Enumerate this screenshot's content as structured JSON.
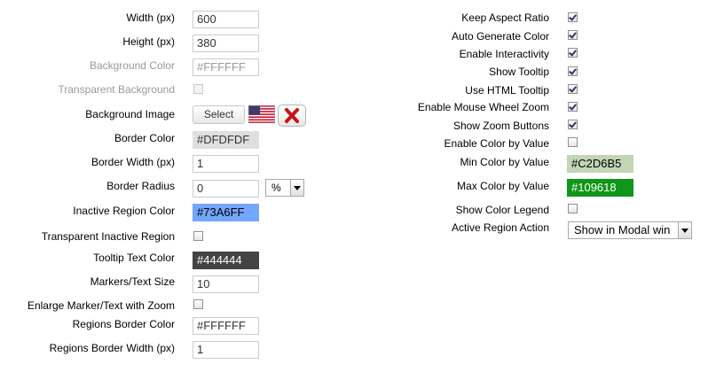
{
  "left": {
    "width": {
      "label": "Width (px)",
      "value": "600"
    },
    "height": {
      "label": "Height (px)",
      "value": "380"
    },
    "background_color": {
      "label": "Background Color",
      "value": "#FFFFFF"
    },
    "transparent_background": {
      "label": "Transparent Background",
      "checked": false
    },
    "background_image": {
      "label": "Background Image",
      "button": "Select"
    },
    "border_color": {
      "label": "Border Color",
      "value": "#DFDFDF",
      "color": "#DFDFDF"
    },
    "border_width": {
      "label": "Border Width (px)",
      "value": "1"
    },
    "border_radius": {
      "label": "Border Radius",
      "value": "0",
      "unit": "%"
    },
    "inactive_region_color": {
      "label": "Inactive Region Color",
      "value": "#73A6FF",
      "color": "#73A6FF"
    },
    "transparent_inactive_region": {
      "label": "Transparent Inactive Region",
      "checked": false
    },
    "tooltip_text_color": {
      "label": "Tooltip Text Color",
      "value": "#444444",
      "color": "#444444"
    },
    "markers_text_size": {
      "label": "Markers/Text Size",
      "value": "10"
    },
    "enlarge_marker": {
      "label": "Enlarge Marker/Text with Zoom",
      "checked": false
    },
    "regions_border_color": {
      "label": "Regions Border Color",
      "value": "#FFFFFF",
      "color": "#FFFFFF"
    },
    "regions_border_width": {
      "label": "Regions Border Width (px)",
      "value": "1"
    }
  },
  "right": {
    "keep_aspect_ratio": {
      "label": "Keep Aspect Ratio",
      "checked": true
    },
    "auto_generate_color": {
      "label": "Auto Generate Color",
      "checked": true
    },
    "enable_interactivity": {
      "label": "Enable Interactivity",
      "checked": true
    },
    "show_tooltip": {
      "label": "Show Tooltip",
      "checked": true
    },
    "use_html_tooltip": {
      "label": "Use HTML Tooltip",
      "checked": true
    },
    "enable_mouse_wheel_zoom": {
      "label": "Enable Mouse Wheel Zoom",
      "checked": true
    },
    "show_zoom_buttons": {
      "label": "Show Zoom Buttons",
      "checked": true
    },
    "enable_color_by_value": {
      "label": "Enable Color by Value",
      "checked": false
    },
    "min_color": {
      "label": "Min Color by Value",
      "value": "#C2D6B5",
      "color": "#C2D6B5"
    },
    "max_color": {
      "label": "Max Color by Value",
      "value": "#109618",
      "color": "#109618"
    },
    "show_color_legend": {
      "label": "Show Color Legend",
      "checked": false
    },
    "active_region_action": {
      "label": "Active Region Action",
      "value": "Show in Modal win"
    }
  },
  "icons": {
    "flag": "us-flag-icon",
    "remove": "red-x-remove-icon"
  }
}
